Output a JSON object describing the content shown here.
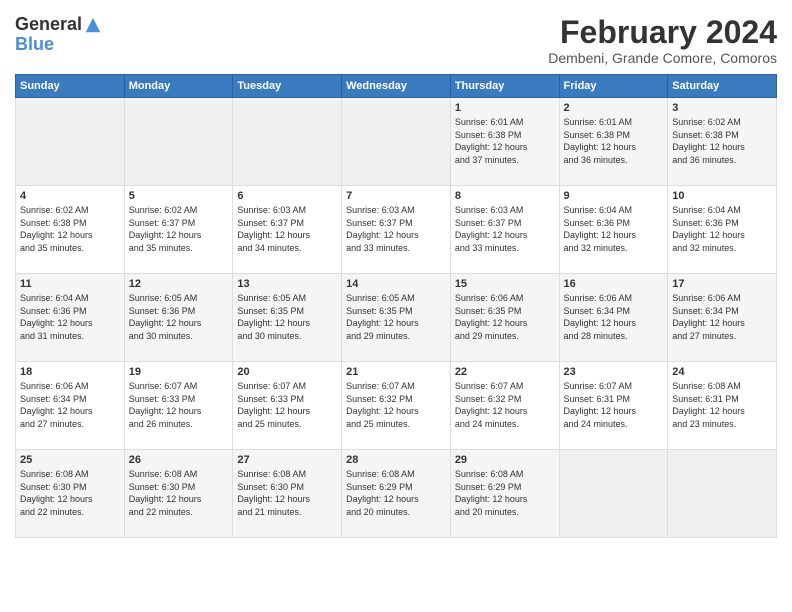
{
  "logo": {
    "line1": "General",
    "line2": "Blue"
  },
  "title": "February 2024",
  "subtitle": "Dembeni, Grande Comore, Comoros",
  "columns": [
    "Sunday",
    "Monday",
    "Tuesday",
    "Wednesday",
    "Thursday",
    "Friday",
    "Saturday"
  ],
  "weeks": [
    [
      {
        "day": "",
        "info": ""
      },
      {
        "day": "",
        "info": ""
      },
      {
        "day": "",
        "info": ""
      },
      {
        "day": "",
        "info": ""
      },
      {
        "day": "1",
        "info": "Sunrise: 6:01 AM\nSunset: 6:38 PM\nDaylight: 12 hours\nand 37 minutes."
      },
      {
        "day": "2",
        "info": "Sunrise: 6:01 AM\nSunset: 6:38 PM\nDaylight: 12 hours\nand 36 minutes."
      },
      {
        "day": "3",
        "info": "Sunrise: 6:02 AM\nSunset: 6:38 PM\nDaylight: 12 hours\nand 36 minutes."
      }
    ],
    [
      {
        "day": "4",
        "info": "Sunrise: 6:02 AM\nSunset: 6:38 PM\nDaylight: 12 hours\nand 35 minutes."
      },
      {
        "day": "5",
        "info": "Sunrise: 6:02 AM\nSunset: 6:37 PM\nDaylight: 12 hours\nand 35 minutes."
      },
      {
        "day": "6",
        "info": "Sunrise: 6:03 AM\nSunset: 6:37 PM\nDaylight: 12 hours\nand 34 minutes."
      },
      {
        "day": "7",
        "info": "Sunrise: 6:03 AM\nSunset: 6:37 PM\nDaylight: 12 hours\nand 33 minutes."
      },
      {
        "day": "8",
        "info": "Sunrise: 6:03 AM\nSunset: 6:37 PM\nDaylight: 12 hours\nand 33 minutes."
      },
      {
        "day": "9",
        "info": "Sunrise: 6:04 AM\nSunset: 6:36 PM\nDaylight: 12 hours\nand 32 minutes."
      },
      {
        "day": "10",
        "info": "Sunrise: 6:04 AM\nSunset: 6:36 PM\nDaylight: 12 hours\nand 32 minutes."
      }
    ],
    [
      {
        "day": "11",
        "info": "Sunrise: 6:04 AM\nSunset: 6:36 PM\nDaylight: 12 hours\nand 31 minutes."
      },
      {
        "day": "12",
        "info": "Sunrise: 6:05 AM\nSunset: 6:36 PM\nDaylight: 12 hours\nand 30 minutes."
      },
      {
        "day": "13",
        "info": "Sunrise: 6:05 AM\nSunset: 6:35 PM\nDaylight: 12 hours\nand 30 minutes."
      },
      {
        "day": "14",
        "info": "Sunrise: 6:05 AM\nSunset: 6:35 PM\nDaylight: 12 hours\nand 29 minutes."
      },
      {
        "day": "15",
        "info": "Sunrise: 6:06 AM\nSunset: 6:35 PM\nDaylight: 12 hours\nand 29 minutes."
      },
      {
        "day": "16",
        "info": "Sunrise: 6:06 AM\nSunset: 6:34 PM\nDaylight: 12 hours\nand 28 minutes."
      },
      {
        "day": "17",
        "info": "Sunrise: 6:06 AM\nSunset: 6:34 PM\nDaylight: 12 hours\nand 27 minutes."
      }
    ],
    [
      {
        "day": "18",
        "info": "Sunrise: 6:06 AM\nSunset: 6:34 PM\nDaylight: 12 hours\nand 27 minutes."
      },
      {
        "day": "19",
        "info": "Sunrise: 6:07 AM\nSunset: 6:33 PM\nDaylight: 12 hours\nand 26 minutes."
      },
      {
        "day": "20",
        "info": "Sunrise: 6:07 AM\nSunset: 6:33 PM\nDaylight: 12 hours\nand 25 minutes."
      },
      {
        "day": "21",
        "info": "Sunrise: 6:07 AM\nSunset: 6:32 PM\nDaylight: 12 hours\nand 25 minutes."
      },
      {
        "day": "22",
        "info": "Sunrise: 6:07 AM\nSunset: 6:32 PM\nDaylight: 12 hours\nand 24 minutes."
      },
      {
        "day": "23",
        "info": "Sunrise: 6:07 AM\nSunset: 6:31 PM\nDaylight: 12 hours\nand 24 minutes."
      },
      {
        "day": "24",
        "info": "Sunrise: 6:08 AM\nSunset: 6:31 PM\nDaylight: 12 hours\nand 23 minutes."
      }
    ],
    [
      {
        "day": "25",
        "info": "Sunrise: 6:08 AM\nSunset: 6:30 PM\nDaylight: 12 hours\nand 22 minutes."
      },
      {
        "day": "26",
        "info": "Sunrise: 6:08 AM\nSunset: 6:30 PM\nDaylight: 12 hours\nand 22 minutes."
      },
      {
        "day": "27",
        "info": "Sunrise: 6:08 AM\nSunset: 6:30 PM\nDaylight: 12 hours\nand 21 minutes."
      },
      {
        "day": "28",
        "info": "Sunrise: 6:08 AM\nSunset: 6:29 PM\nDaylight: 12 hours\nand 20 minutes."
      },
      {
        "day": "29",
        "info": "Sunrise: 6:08 AM\nSunset: 6:29 PM\nDaylight: 12 hours\nand 20 minutes."
      },
      {
        "day": "",
        "info": ""
      },
      {
        "day": "",
        "info": ""
      }
    ]
  ]
}
